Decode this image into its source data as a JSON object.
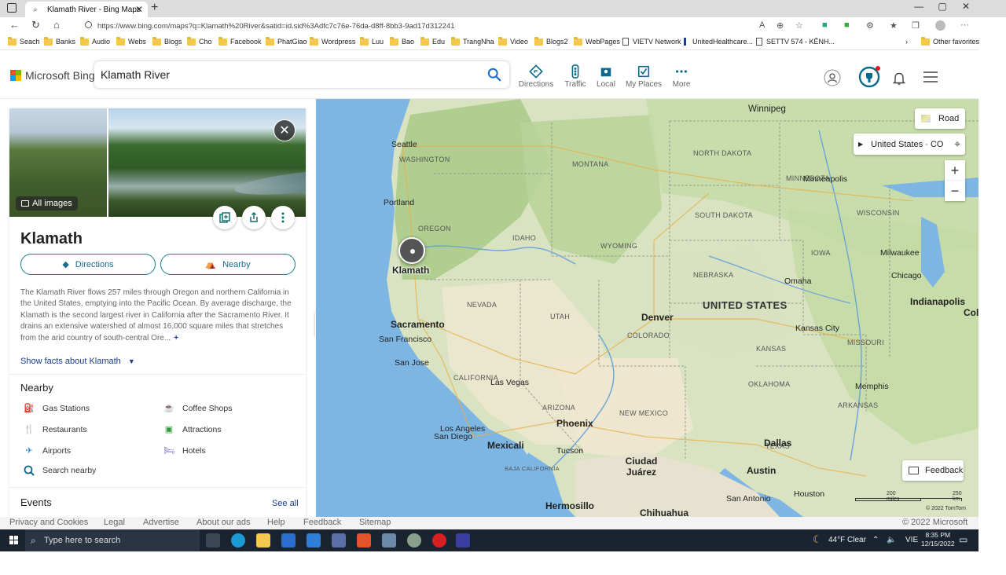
{
  "browser": {
    "tab_title": "Klamath River - Bing Maps",
    "url": "https://www.bing.com/maps?q=Klamath%20River&satid=id.sid%3Adfc7c76e-76da-d8ff-8bb3-9ad17d312241",
    "bookmarks": [
      "Seach",
      "Banks",
      "Audio",
      "Webs",
      "Blogs",
      "Cho",
      "Facebook",
      "PhatGiao",
      "Wordpress",
      "Luu",
      "Bao",
      "Edu",
      "TrangNha",
      "Video",
      "Blogs2",
      "WebPages",
      "VIETV Network",
      "UnitedHealthcare...",
      "SETTV 574 - KÊNH...",
      "Other favorites"
    ]
  },
  "header": {
    "logo": "Microsoft Bing",
    "search_value": "Klamath River",
    "nav": [
      {
        "label": "Directions",
        "icon": "directions-icon"
      },
      {
        "label": "Traffic",
        "icon": "traffic-icon"
      },
      {
        "label": "Local",
        "icon": "local-icon"
      },
      {
        "label": "My Places",
        "icon": "my-places-icon"
      },
      {
        "label": "More",
        "icon": "more-icon"
      }
    ]
  },
  "panel": {
    "all_images": "All images",
    "title": "Klamath",
    "directions_label": "Directions",
    "nearby_label": "Nearby",
    "description": "The Klamath River flows 257 miles through Oregon and northern California in the United States, emptying into the Pacific Ocean. By average discharge, the Klamath is the second largest river in California after the Sacramento River. It drains an extensive watershed of almost 16,000 square miles that stretches from the arid country of south-central Ore...",
    "more": "+",
    "facts_link": "Show facts about Klamath",
    "nearby_heading": "Nearby",
    "nearby_items": [
      {
        "label": "Gas Stations",
        "icon": "gas-station-icon",
        "color": "#c8762a"
      },
      {
        "label": "Coffee Shops",
        "icon": "coffee-icon",
        "color": "#e0742b"
      },
      {
        "label": "Restaurants",
        "icon": "restaurant-icon",
        "color": "#c8762a"
      },
      {
        "label": "Attractions",
        "icon": "attraction-icon",
        "color": "#2e9c3a"
      },
      {
        "label": "Airports",
        "icon": "airport-icon",
        "color": "#2a8fd0"
      },
      {
        "label": "Hotels",
        "icon": "hotel-icon",
        "color": "#6a5bd0"
      }
    ],
    "search_nearby": "Search nearby",
    "events_heading": "Events",
    "see_all": "See all"
  },
  "map": {
    "road_label": "Road",
    "location_label": "United States · CO",
    "feedback_label": "Feedback",
    "scale_miles": "200 miles",
    "scale_km": "250 km",
    "attribution": "© 2022 TomTom",
    "pin_label": "Klamath",
    "country_label": "UNITED STATES",
    "states": [
      "WASHINGTON",
      "MONTANA",
      "NORTH DAKOTA",
      "MINNESOTA",
      "OREGON",
      "IDAHO",
      "SOUTH DAKOTA",
      "WISCONSIN",
      "WYOMING",
      "IOWA",
      "NEBRASKA",
      "NEVADA",
      "UTAH",
      "COLORADO",
      "KANSAS",
      "MISSOURI",
      "CALIFORNIA",
      "ARIZONA",
      "NEW MEXICO",
      "OKLAHOMA",
      "ARKANSAS",
      "TEXAS",
      "BAJA CALIFORNIA"
    ],
    "cities": [
      "Winnipeg",
      "Seattle",
      "Portland",
      "Sacramento",
      "San Francisco",
      "San Jose",
      "Las Vegas",
      "Los Angeles",
      "San Diego",
      "Mexicali",
      "Tucson",
      "Phoenix",
      "Denver",
      "Kansas City",
      "Omaha",
      "Minneapolis",
      "Milwaukee",
      "Chicago",
      "Indianapolis",
      "Colum",
      "Dallas",
      "Austin",
      "Houston",
      "San Antonio",
      "Memphis",
      "Ciudad Juárez",
      "Hermosillo",
      "Chihuahua"
    ]
  },
  "footer": {
    "links": [
      "Privacy and Cookies",
      "Legal",
      "Advertise",
      "About our ads",
      "Help",
      "Feedback",
      "Sitemap"
    ],
    "copyright": "© 2022 Microsoft"
  },
  "taskbar": {
    "search_placeholder": "Type here to search",
    "weather": "44°F  Clear",
    "lang": "VIE",
    "time": "8:35 PM",
    "date": "12/15/2022"
  }
}
